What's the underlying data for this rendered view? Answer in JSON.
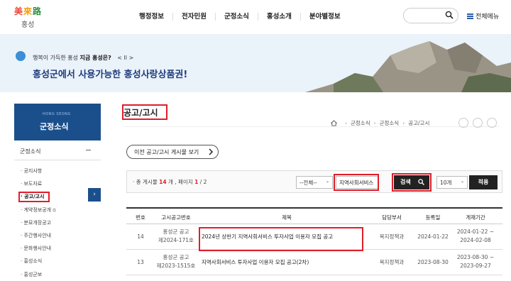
{
  "header": {
    "logo_text": "美來路",
    "logo_sub": "홍성",
    "nav": [
      "행정정보",
      "전자민원",
      "군정소식",
      "홍성소개",
      "분야별정보"
    ],
    "all_menu_label": "전체메뉴"
  },
  "banner": {
    "line1_prefix": "행복이 가득한 홍성",
    "line1_bold": "지금 홍성은?",
    "line1_controls": "< ll >",
    "headline": "홍성군에서 사용가능한 홍성사랑상품권!"
  },
  "sidebar": {
    "head_en": "HONG SEONG",
    "head_title": "군정소식",
    "category": "군정소식",
    "items": [
      {
        "label": "· 공지사항"
      },
      {
        "label": "· 보도자료"
      },
      {
        "label": "· 공고/고시"
      },
      {
        "label": "· 계약정보공개"
      },
      {
        "label": "· 분묘개장공고"
      },
      {
        "label": "· 주간행사안내"
      },
      {
        "label": "· 문화행사안내"
      },
      {
        "label": "· 홍성소식"
      },
      {
        "label": "· 홍성군보"
      }
    ],
    "arrow": "›"
  },
  "page": {
    "title": "공고/고시",
    "breadcrumb": [
      "군정소식",
      "군정소식",
      "공고/고시"
    ],
    "prev_button": "이전 공고/고시 게시물 보기"
  },
  "filter": {
    "count_prefix": "· 총 게시물 ",
    "count": "14",
    "count_suffix": " 개 , 페이지 ",
    "page_current": "1",
    "page_total": " / 2",
    "select_value": "--전체--",
    "search_value": "지역사회서비스",
    "search_label": "검색",
    "per_page": "10개",
    "apply_label": "적용"
  },
  "table": {
    "headers": [
      "번호",
      "고시공고번호",
      "제목",
      "담당부서",
      "등록일",
      "게재기간"
    ],
    "rows": [
      {
        "num": "14",
        "code1": "홍성군 공고",
        "code2": "제2024-171호",
        "title": "2024년 상반기 지역사회서비스 투자사업 이용자 모집 공고",
        "dept": "복지정책과",
        "date": "2024-01-22",
        "period1": "2024-01-22 ~",
        "period2": "2024-02-08"
      },
      {
        "num": "13",
        "code1": "홍성군 공고",
        "code2": "제2023-1515호",
        "title": "지역사회서비스 투자사업 이용자 모집 공고(2차)",
        "dept": "복지정책과",
        "date": "2023-08-30",
        "period1": "2023-08-30 ~",
        "period2": "2023-09-27"
      }
    ]
  },
  "colors": {
    "brand_blue": "#1b4f8c",
    "highlight_red": "#e01e2b"
  }
}
